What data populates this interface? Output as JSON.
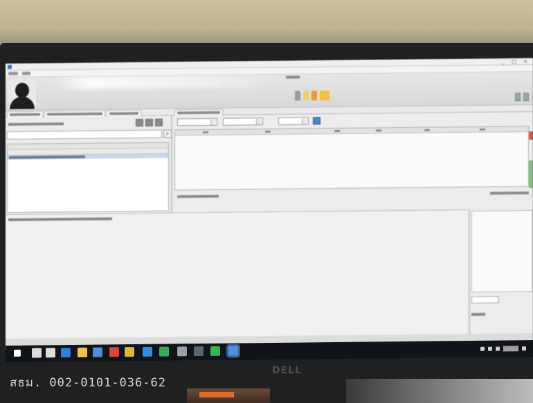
{
  "window": {
    "title": "",
    "controls": "_ □ ×"
  },
  "header": {
    "center_text": ""
  },
  "left_panel": {
    "search_placeholder": "",
    "search_button_glyph": "⌕"
  },
  "taskbar": {
    "apps": [
      {
        "name": "start",
        "color": "#ffffff"
      },
      {
        "name": "search",
        "color": "#dddddd"
      },
      {
        "name": "task-view",
        "color": "#dddddd"
      },
      {
        "name": "edge",
        "color": "#2f7fd8"
      },
      {
        "name": "explorer",
        "color": "#f2c14e"
      },
      {
        "name": "mail",
        "color": "#4a8fd8"
      },
      {
        "name": "chrome",
        "color": "#d8463c"
      },
      {
        "name": "chrome-2",
        "color": "#e0b63a"
      },
      {
        "name": "app-blue",
        "color": "#2f8de0"
      },
      {
        "name": "app-green",
        "color": "#3aa85a"
      },
      {
        "name": "app-gray",
        "color": "#9aa0a6"
      },
      {
        "name": "app-dark",
        "color": "#5a6370"
      },
      {
        "name": "app-green-2",
        "color": "#39b54a"
      },
      {
        "name": "app-active",
        "color": "#4a90e2"
      }
    ]
  },
  "bezel": {
    "asset_label": "สธม. 002-0101-036-62",
    "brand": "DELL"
  },
  "colors": {
    "accent_blue": "#3f86d4",
    "selection": "#c8d7ea",
    "status_green": "#7fbf7f",
    "status_red": "#d9534f"
  }
}
